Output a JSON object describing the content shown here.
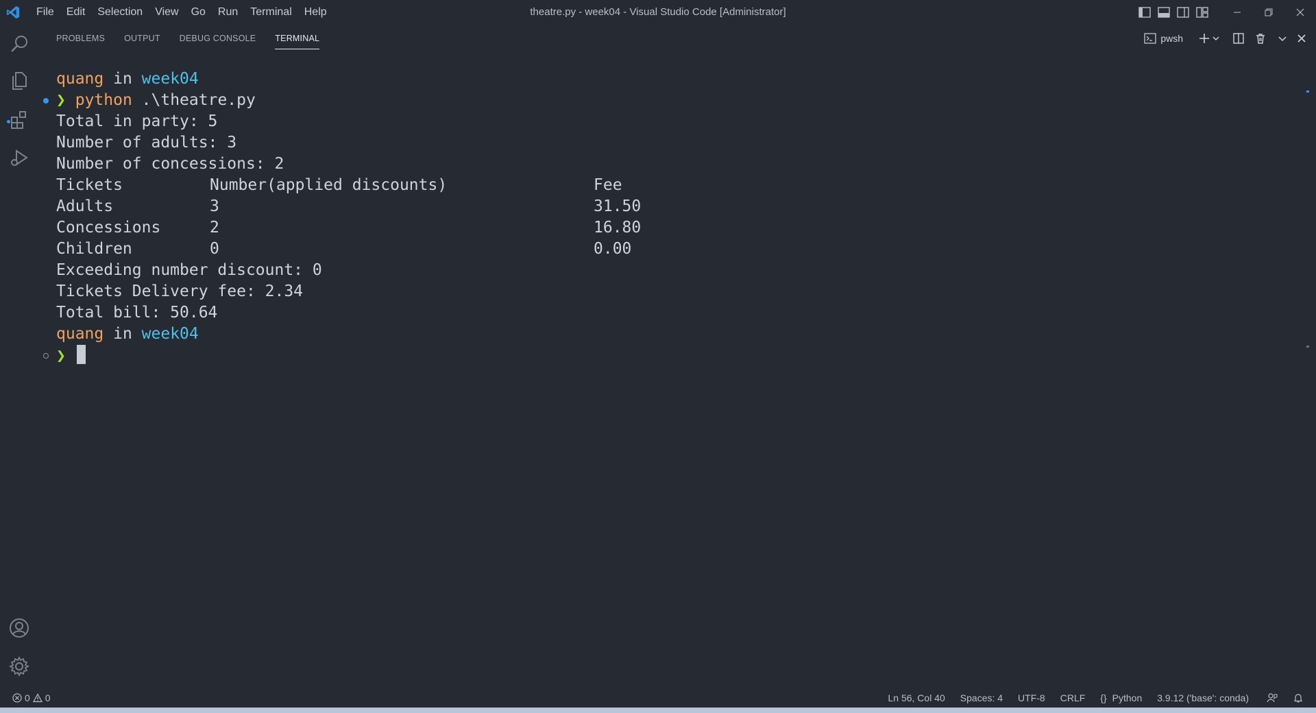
{
  "titlebar": {
    "menu": [
      "File",
      "Edit",
      "Selection",
      "View",
      "Go",
      "Run",
      "Terminal",
      "Help"
    ],
    "title": "theatre.py - week04 - Visual Studio Code [Administrator]"
  },
  "panel": {
    "tabs": [
      "PROBLEMS",
      "OUTPUT",
      "DEBUG CONSOLE",
      "TERMINAL"
    ],
    "active_tab": "TERMINAL",
    "shell": "pwsh"
  },
  "terminal": {
    "user": "quang",
    "in_word": "in",
    "dir": "week04",
    "prompt_symbol": "❯",
    "command": "python",
    "command_arg": ".\\theatre.py",
    "output": [
      "Total in party: 5",
      "Number of adults: 3",
      "Number of concessions: 2"
    ],
    "table": [
      [
        "Tickets",
        "Number(applied discounts)",
        "Fee"
      ],
      [
        "Adults",
        "3",
        "31.50"
      ],
      [
        "Concessions",
        "2",
        "16.80"
      ],
      [
        "Children",
        "0",
        "0.00"
      ]
    ],
    "summary": [
      "Exceeding number discount: 0",
      "Tickets Delivery fee: 2.34",
      "Total bill: 50.64"
    ]
  },
  "statusbar": {
    "errors": "0",
    "warnings": "0",
    "position": "Ln 56, Col 40",
    "spaces": "Spaces: 4",
    "encoding": "UTF-8",
    "eol": "CRLF",
    "language_braces": "{}",
    "language": "Python",
    "interpreter": "3.9.12 ('base': conda)"
  },
  "colors": {
    "background": "#262a33",
    "user": "#f0a35e",
    "dir": "#4fc1e9",
    "prompt": "#a6e22e",
    "accent": "#3794ff"
  }
}
